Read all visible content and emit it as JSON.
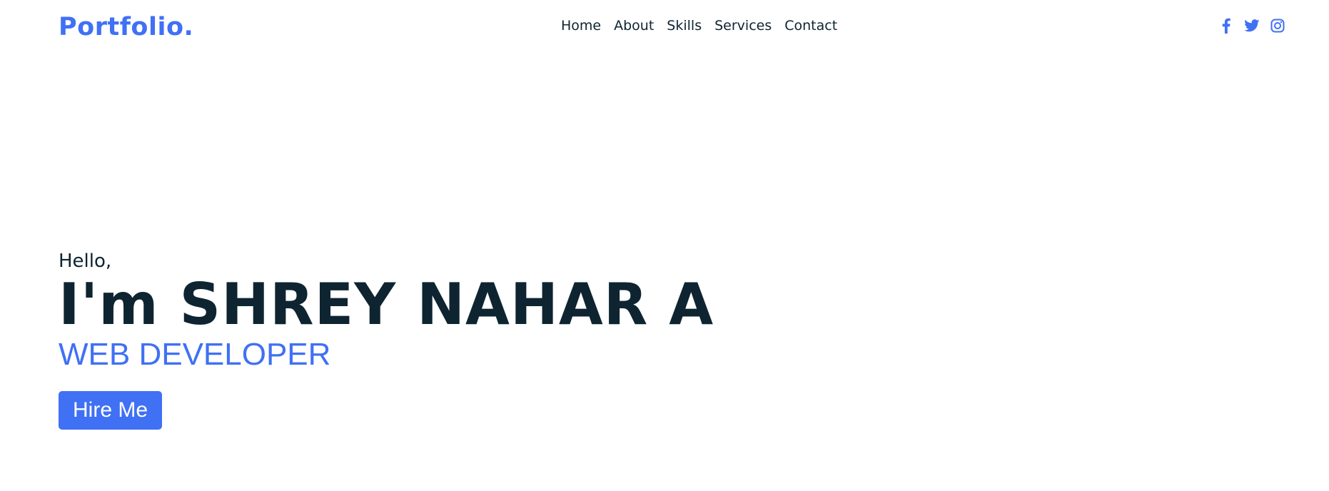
{
  "header": {
    "logo": "Portfolio.",
    "nav": [
      {
        "label": "Home"
      },
      {
        "label": "About"
      },
      {
        "label": "Skills"
      },
      {
        "label": "Services"
      },
      {
        "label": "Contact"
      }
    ],
    "social": [
      {
        "icon": "facebook-icon"
      },
      {
        "icon": "twitter-icon"
      },
      {
        "icon": "instagram-icon"
      }
    ]
  },
  "hero": {
    "greeting": "Hello,",
    "name": "I'm SHREY NAHAR A",
    "role": "WEB DEVELOPER",
    "cta_label": "Hire Me"
  },
  "colors": {
    "accent": "#4070f4",
    "text": "#0e2431",
    "background": "#ffffff"
  }
}
